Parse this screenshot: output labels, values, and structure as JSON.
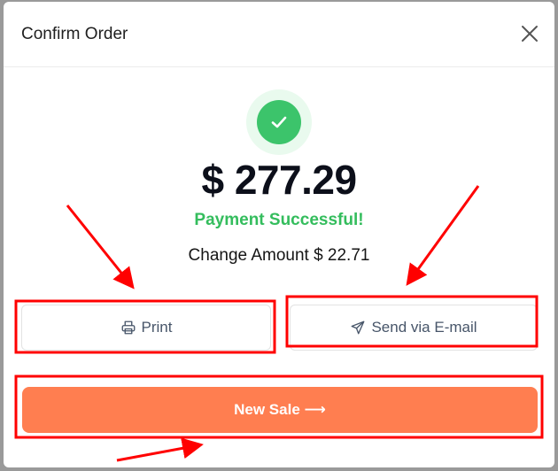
{
  "modal": {
    "title": "Confirm Order"
  },
  "payment": {
    "amount": "$ 277.29",
    "status": "Payment Successful!",
    "change": "Change Amount $ 22.71"
  },
  "actions": {
    "print_label": "Print",
    "email_label": "Send via E-mail",
    "new_sale_label": "New Sale ⟶"
  },
  "icons": {
    "close": "close-icon",
    "success": "check-icon",
    "print": "printer-icon",
    "email": "send-icon"
  },
  "colors": {
    "success_green": "#3cc46b",
    "status_text": "#34bd5d",
    "new_sale_button": "#ff7e50",
    "annotation_red": "#ff0000"
  }
}
